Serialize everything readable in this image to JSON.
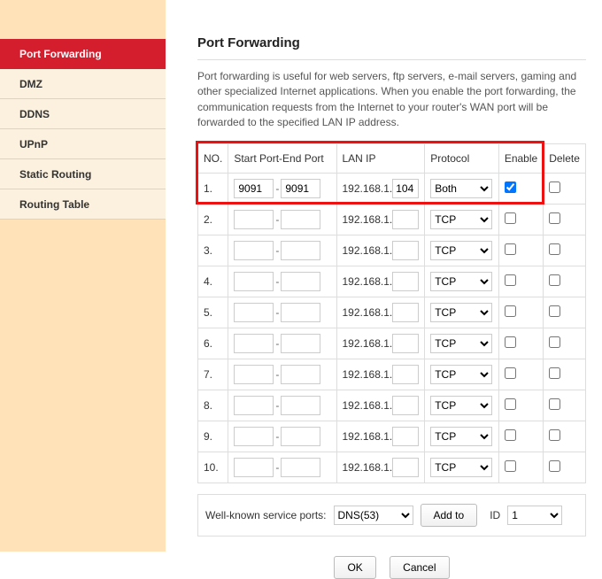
{
  "sidebar": {
    "items": [
      {
        "label": "Port Forwarding",
        "name": "nav-port-forwarding",
        "active": true
      },
      {
        "label": "DMZ",
        "name": "nav-dmz",
        "active": false
      },
      {
        "label": "DDNS",
        "name": "nav-ddns",
        "active": false
      },
      {
        "label": "UPnP",
        "name": "nav-upnp",
        "active": false
      },
      {
        "label": "Static Routing",
        "name": "nav-static-routing",
        "active": false
      },
      {
        "label": "Routing Table",
        "name": "nav-routing-table",
        "active": false
      }
    ]
  },
  "page": {
    "title": "Port Forwarding",
    "description": "Port forwarding is useful for web servers, ftp servers, e-mail servers, gaming and other specialized Internet applications. When you enable the port forwarding, the communication requests from the Internet to your router's WAN port will be forwarded to the specified LAN IP address."
  },
  "table": {
    "headers": {
      "no": "NO.",
      "ports": "Start Port-End Port",
      "lan": "LAN IP",
      "proto": "Protocol",
      "enable": "Enable",
      "delete": "Delete"
    },
    "lan_prefix": "192.168.1.",
    "port_separator": "-",
    "rows": [
      {
        "no": "1.",
        "start": "9091",
        "end": "9091",
        "lan_last": "104",
        "proto": "Both",
        "enable": true,
        "delete": false,
        "highlight": true
      },
      {
        "no": "2.",
        "start": "",
        "end": "",
        "lan_last": "",
        "proto": "TCP",
        "enable": false,
        "delete": false
      },
      {
        "no": "3.",
        "start": "",
        "end": "",
        "lan_last": "",
        "proto": "TCP",
        "enable": false,
        "delete": false
      },
      {
        "no": "4.",
        "start": "",
        "end": "",
        "lan_last": "",
        "proto": "TCP",
        "enable": false,
        "delete": false
      },
      {
        "no": "5.",
        "start": "",
        "end": "",
        "lan_last": "",
        "proto": "TCP",
        "enable": false,
        "delete": false
      },
      {
        "no": "6.",
        "start": "",
        "end": "",
        "lan_last": "",
        "proto": "TCP",
        "enable": false,
        "delete": false
      },
      {
        "no": "7.",
        "start": "",
        "end": "",
        "lan_last": "",
        "proto": "TCP",
        "enable": false,
        "delete": false
      },
      {
        "no": "8.",
        "start": "",
        "end": "",
        "lan_last": "",
        "proto": "TCP",
        "enable": false,
        "delete": false
      },
      {
        "no": "9.",
        "start": "",
        "end": "",
        "lan_last": "",
        "proto": "TCP",
        "enable": false,
        "delete": false
      },
      {
        "no": "10.",
        "start": "",
        "end": "",
        "lan_last": "",
        "proto": "TCP",
        "enable": false,
        "delete": false
      }
    ]
  },
  "wellknown": {
    "label": "Well-known service ports:",
    "selected": "DNS(53)",
    "add_label": "Add to",
    "id_label": "ID",
    "id_selected": "1"
  },
  "actions": {
    "ok": "OK",
    "cancel": "Cancel"
  }
}
